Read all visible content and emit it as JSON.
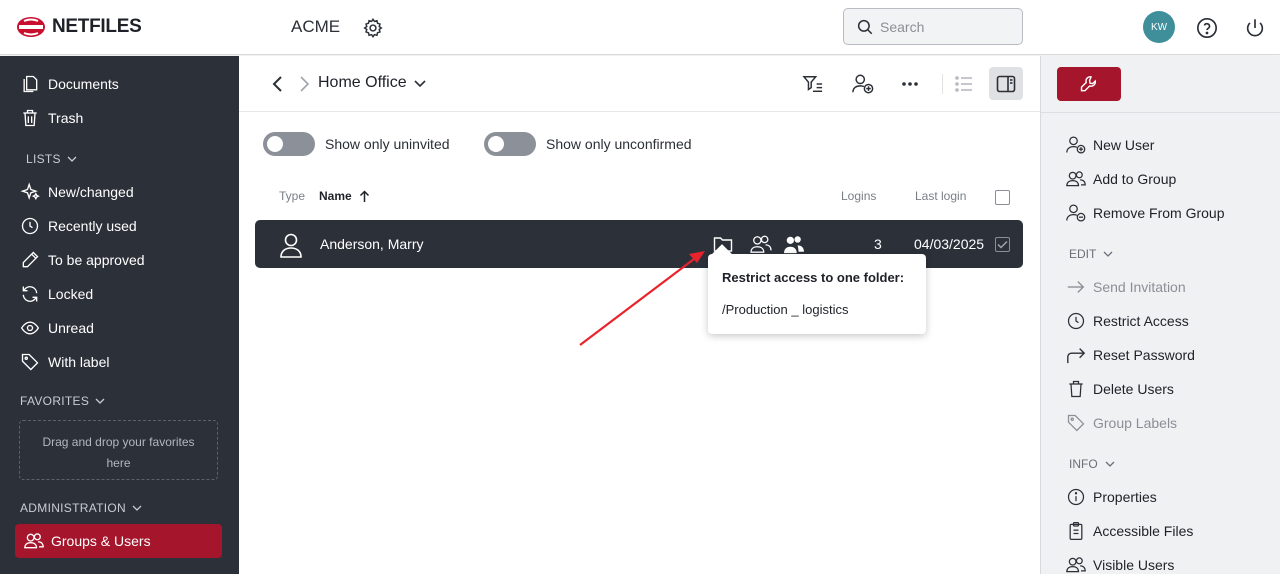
{
  "header": {
    "logo_text": "NETFILES",
    "company": "ACME",
    "search_placeholder": "Search",
    "avatar_initials": "KW"
  },
  "sidebar": {
    "items": [
      {
        "label": "Documents",
        "icon": "documents-icon"
      },
      {
        "label": "Trash",
        "icon": "trash-icon"
      }
    ],
    "lists_label": "LISTS",
    "lists": [
      {
        "label": "New/changed",
        "icon": "sparkle-icon"
      },
      {
        "label": "Recently used",
        "icon": "clock-icon"
      },
      {
        "label": "To be approved",
        "icon": "pen-icon"
      },
      {
        "label": "Locked",
        "icon": "refresh-lock-icon"
      },
      {
        "label": "Unread",
        "icon": "eye-icon"
      },
      {
        "label": "With label",
        "icon": "tag-icon"
      }
    ],
    "favorites_label": "FAVORITES",
    "favorites_drop": "Drag and drop your favorites here",
    "administration_label": "ADMINISTRATION",
    "active_item": "Groups & Users"
  },
  "main": {
    "breadcrumb": "Home Office",
    "toggles": [
      {
        "label": "Show only uninvited"
      },
      {
        "label": "Show only unconfirmed"
      }
    ],
    "columns": {
      "type": "Type",
      "name": "Name",
      "logins": "Logins",
      "last_login": "Last login"
    },
    "rows": [
      {
        "name": "Anderson, Marry",
        "logins": "3",
        "last_login": "04/03/2025"
      }
    ],
    "tooltip": {
      "title": "Restrict access to one folder:",
      "path": "/Production _ logistics"
    }
  },
  "right_panel": {
    "actions": [
      {
        "label": "New User",
        "icon": "add-user-icon"
      },
      {
        "label": "Add to Group",
        "icon": "users-icon"
      },
      {
        "label": "Remove From Group",
        "icon": "remove-user-icon"
      }
    ],
    "edit_label": "EDIT",
    "edit": [
      {
        "label": "Send Invitation",
        "icon": "arrow-right-icon"
      },
      {
        "label": "Restrict Access",
        "icon": "clock-icon"
      },
      {
        "label": "Reset Password",
        "icon": "redo-icon"
      },
      {
        "label": "Delete Users",
        "icon": "trash-icon"
      },
      {
        "label": "Group Labels",
        "icon": "tag-icon"
      }
    ],
    "info_label": "INFO",
    "info": [
      {
        "label": "Properties",
        "icon": "info-icon"
      },
      {
        "label": "Accessible Files",
        "icon": "clipboard-icon"
      },
      {
        "label": "Visible Users",
        "icon": "users-icon"
      }
    ]
  },
  "colors": {
    "brand": "#a5152b",
    "sidebar_bg": "#2c3039",
    "avatar": "#3f8f9a"
  }
}
